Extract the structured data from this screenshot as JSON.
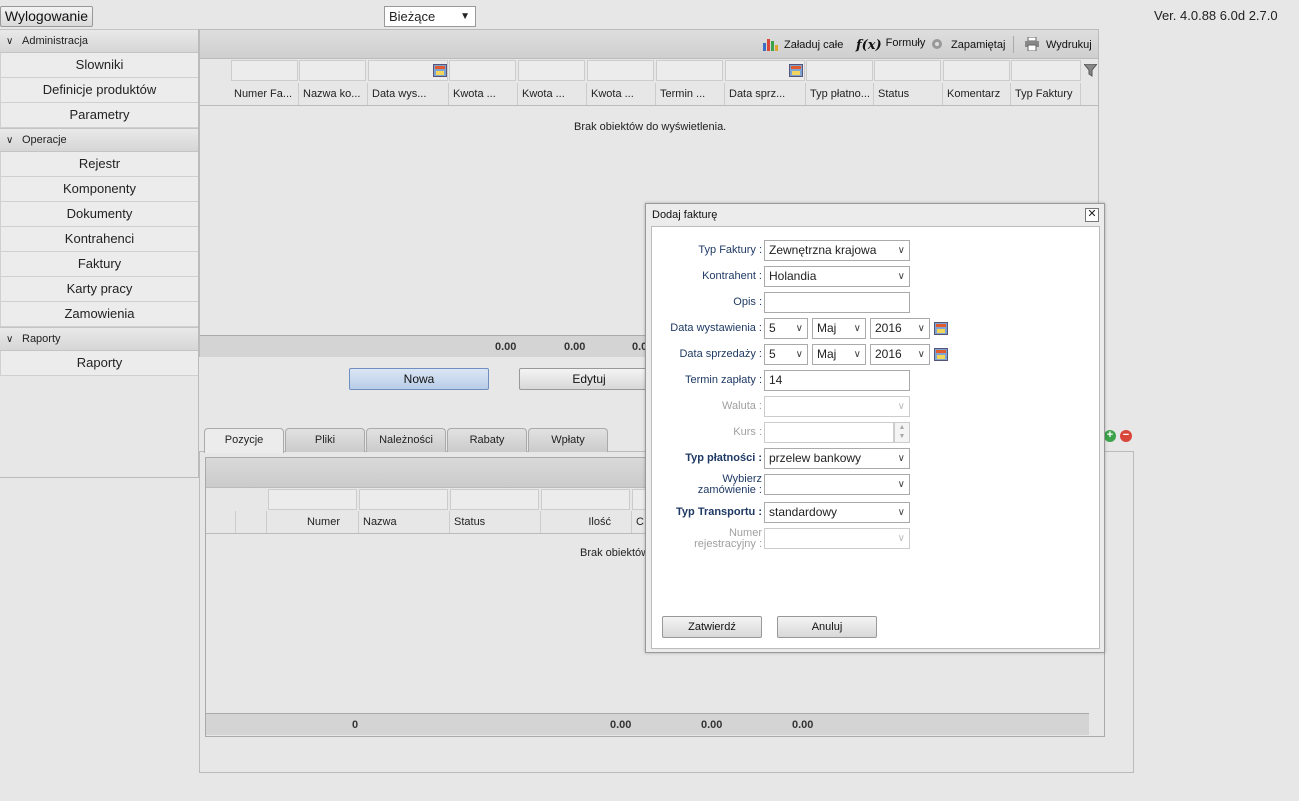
{
  "topbar": {
    "logout_label": "Wylogowanie",
    "period_value": "Bieżące",
    "version": "Ver. 4.0.88 6.0d 2.7.0"
  },
  "sidebar": {
    "sections": [
      {
        "title": "Administracja",
        "items": [
          "Slowniki",
          "Definicje produktów",
          "Parametry"
        ]
      },
      {
        "title": "Operacje",
        "items": [
          "Rejestr",
          "Komponenty",
          "Dokumenty",
          "Kontrahenci",
          "Faktury",
          "Karty pracy",
          "Zamowienia"
        ]
      },
      {
        "title": "Raporty",
        "items": [
          "Raporty"
        ]
      }
    ]
  },
  "toolbar": {
    "load_all": "Załaduj całe",
    "formulas": "Formuły",
    "save": "Zapamiętaj",
    "print": "Wydrukuj"
  },
  "grid": {
    "columns": [
      "Numer Fa...",
      "Nazwa ko...",
      "Data wys...",
      "Kwota ...",
      "Kwota ...",
      "Kwota ...",
      "Termin ...",
      "Data sprz...",
      "Typ płatno...",
      "Status",
      "Komentarz",
      "Typ Faktury"
    ],
    "empty_message": "Brak obiektów do wyświetlenia.",
    "sums": [
      "0.00",
      "0.00",
      "0.0"
    ]
  },
  "actions": {
    "new": "Nowa",
    "edit": "Edytuj"
  },
  "tabs": [
    "Pozycje",
    "Pliki",
    "Należności",
    "Rabaty",
    "Wpłaty"
  ],
  "subgrid": {
    "columns": [
      "Numer",
      "Nazwa",
      "Status",
      "Ilość",
      "C"
    ],
    "empty_message": "Brak obiektów",
    "sums": [
      "0",
      "0.00",
      "0.00",
      "0.00"
    ]
  },
  "dialog": {
    "title": "Dodaj fakturę",
    "fields": {
      "typ_faktury": {
        "label": "Typ Faktury :",
        "value": "Zewnętrzna krajowa"
      },
      "kontrahent": {
        "label": "Kontrahent :",
        "value": "Holandia"
      },
      "opis": {
        "label": "Opis :",
        "value": ""
      },
      "data_wystawienia": {
        "label": "Data wystawienia :",
        "day": "5",
        "month": "Maj",
        "year": "2016"
      },
      "data_sprzedazy": {
        "label": "Data sprzedaży :",
        "day": "5",
        "month": "Maj",
        "year": "2016"
      },
      "termin_zaplaty": {
        "label": "Termin zapłaty :",
        "value": "14"
      },
      "waluta": {
        "label": "Waluta :",
        "value": ""
      },
      "kurs": {
        "label": "Kurs :",
        "value": ""
      },
      "typ_platnosci": {
        "label": "Typ płatności :",
        "value": "przelew bankowy"
      },
      "wybierz_zamowienie": {
        "label_line1": "Wybierz",
        "label_line2": "zamówienie :",
        "value": ""
      },
      "typ_transportu": {
        "label": "Typ Transportu :",
        "value": "standardowy"
      },
      "numer_rejestracyjny": {
        "label_line1": "Numer",
        "label_line2": "rejestracyjny :",
        "value": ""
      }
    },
    "confirm": "Zatwierdź",
    "cancel": "Anuluj"
  }
}
